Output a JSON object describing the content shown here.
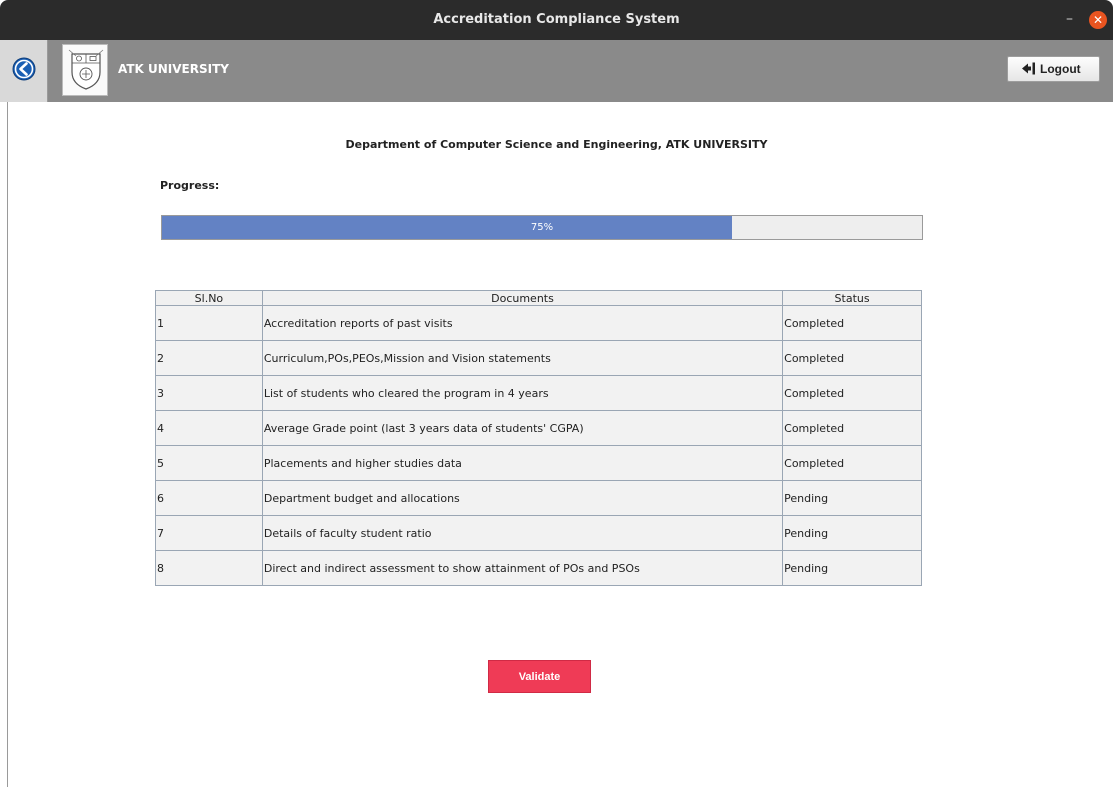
{
  "window": {
    "title": "Accreditation Compliance System",
    "minimize_glyph": "–",
    "close_glyph": "✕"
  },
  "header": {
    "university_name": "ATK UNIVERSITY",
    "back_icon": "back-arrow-icon",
    "logo_icon": "university-crest-icon",
    "logout_label": "Logout",
    "logout_icon": "logout-icon"
  },
  "main": {
    "department_title": "Department of Computer Science and Engineering, ATK UNIVERSITY",
    "progress_label": "Progress:",
    "progress_text": "75%",
    "progress_value": 75
  },
  "table": {
    "headers": [
      "Sl.No",
      "Documents",
      "Status"
    ],
    "rows": [
      [
        "1",
        "Accreditation reports of past visits",
        "Completed"
      ],
      [
        "2",
        "Curriculum,POs,PEOs,Mission and Vision statements",
        "Completed"
      ],
      [
        "3",
        "List of students who cleared the program in 4 years",
        "Completed"
      ],
      [
        "4",
        "Average Grade point (last 3 years data of students' CGPA)",
        "Completed"
      ],
      [
        "5",
        "Placements and higher studies data",
        "Completed"
      ],
      [
        "6",
        "Department budget and allocations",
        "Pending"
      ],
      [
        "7",
        "Details of faculty student ratio",
        "Pending"
      ],
      [
        "8",
        "Direct and indirect assessment to show attainment of POs and PSOs",
        "Pending"
      ]
    ]
  },
  "actions": {
    "validate_label": "Validate"
  },
  "colors": {
    "progress_fill": "#6382c4",
    "validate_bg": "#ef3b56",
    "header_bg": "#8a8a8a",
    "titlebar_bg": "#2b2b2b"
  }
}
